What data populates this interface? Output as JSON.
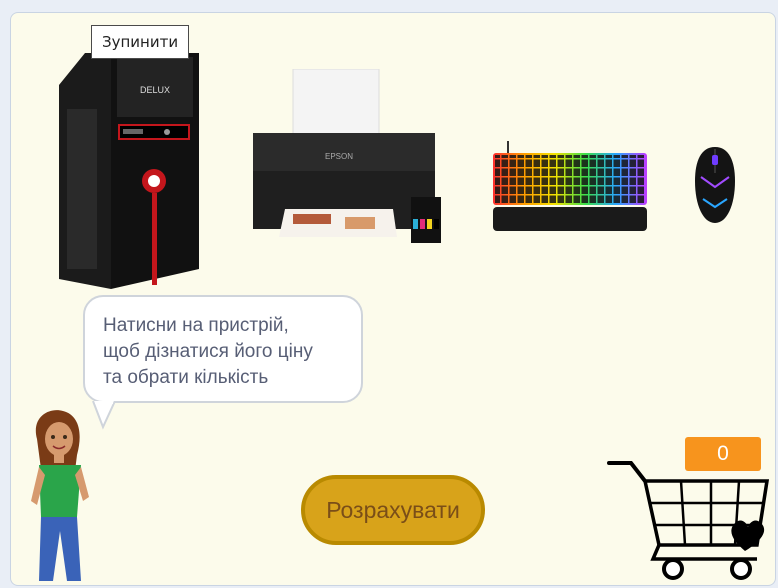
{
  "stage": {
    "stop_label": "Зупинити",
    "speech": {
      "lines": [
        "Натисни на пристрій,",
        "щоб дізнатися його ціну",
        "та обрати кількість"
      ]
    },
    "calculate_label": "Розрахувати",
    "cart_count": "0"
  },
  "devices": [
    {
      "name": "pc-case",
      "logo": "DELUX"
    },
    {
      "name": "printer",
      "logo": "EPSON"
    },
    {
      "name": "keyboard"
    },
    {
      "name": "mouse"
    }
  ],
  "colors": {
    "stage_bg": "#fcfbeb",
    "calculate_button": "#d8a31a",
    "counter_bg": "#f7941d",
    "speech_text": "#575e75"
  }
}
